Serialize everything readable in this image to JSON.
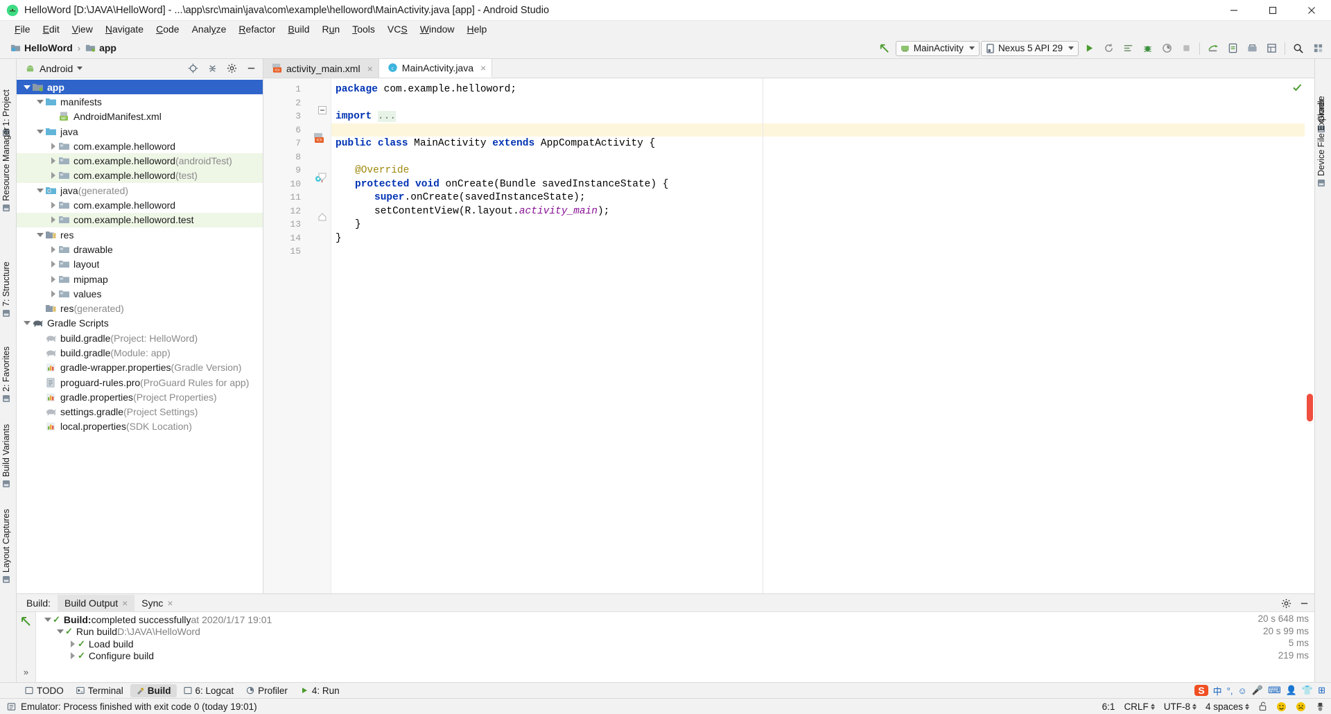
{
  "window": {
    "title": "HelloWord [D:\\JAVA\\HelloWord] - ...\\app\\src\\main\\java\\com\\example\\helloword\\MainActivity.java [app] - Android Studio",
    "icon": "android-studio-logo-icon",
    "controls": {
      "minimize": "minimize-icon",
      "maximize": "maximize-icon",
      "close": "close-icon"
    }
  },
  "menubar": {
    "items": [
      {
        "label": "File",
        "mnemonic": "F"
      },
      {
        "label": "Edit",
        "mnemonic": "E"
      },
      {
        "label": "View",
        "mnemonic": "V"
      },
      {
        "label": "Navigate",
        "mnemonic": "N"
      },
      {
        "label": "Code",
        "mnemonic": "C"
      },
      {
        "label": "Analyze",
        "mnemonic": "y"
      },
      {
        "label": "Refactor",
        "mnemonic": "R"
      },
      {
        "label": "Build",
        "mnemonic": "B"
      },
      {
        "label": "Run",
        "mnemonic": "u"
      },
      {
        "label": "Tools",
        "mnemonic": "T"
      },
      {
        "label": "VCS",
        "mnemonic": "S"
      },
      {
        "label": "Window",
        "mnemonic": "W"
      },
      {
        "label": "Help",
        "mnemonic": "H"
      }
    ]
  },
  "breadcrumb": {
    "items": [
      {
        "label": "HelloWord",
        "icon": "project-folder-icon"
      },
      {
        "label": "app",
        "icon": "module-folder-icon"
      }
    ],
    "separator": "›"
  },
  "toolbar": {
    "back_icon": "back-arrow-icon",
    "run_config": {
      "label": "MainActivity",
      "icon": "android-module-icon"
    },
    "device": {
      "label": "Nexus 5 API 29",
      "icon": "device-icon"
    },
    "buttons": [
      {
        "name": "run-button",
        "icon": "play-icon",
        "color": "#4a9b2f"
      },
      {
        "name": "apply-changes-button",
        "icon": "apply-changes-icon"
      },
      {
        "name": "apply-code-changes-button",
        "icon": "code-changes-icon"
      },
      {
        "name": "debug-button",
        "icon": "bug-icon",
        "color": "#3d9140"
      },
      {
        "name": "profile-button",
        "icon": "profiler-icon"
      },
      {
        "name": "stop-button",
        "icon": "stop-icon"
      },
      {
        "name": "sync-gradle-button",
        "icon": "gradle-sync-icon"
      },
      {
        "name": "avd-manager-button",
        "icon": "avd-manager-icon"
      },
      {
        "name": "sdk-manager-button",
        "icon": "sdk-manager-icon"
      },
      {
        "name": "layout-inspector-button",
        "icon": "layout-inspector-icon"
      },
      {
        "name": "search-everywhere-button",
        "icon": "search-icon"
      },
      {
        "name": "project-structure-button",
        "icon": "project-structure-icon"
      }
    ]
  },
  "left_rail": {
    "items": [
      {
        "label": "1: Project",
        "icon": "project-icon"
      },
      {
        "label": "Resource Manager",
        "icon": "resource-manager-icon"
      },
      {
        "label": "7: Structure",
        "icon": "structure-icon"
      },
      {
        "label": "2: Favorites",
        "icon": "favorites-icon"
      },
      {
        "label": "Build Variants",
        "icon": "build-variants-icon"
      },
      {
        "label": "Layout Captures",
        "icon": "layout-captures-icon"
      }
    ]
  },
  "right_rail": {
    "items": [
      {
        "label": "Gradle",
        "icon": "gradle-icon"
      },
      {
        "label": "Device File Explorer",
        "icon": "device-file-explorer-icon"
      }
    ]
  },
  "project_panel": {
    "view_selector": {
      "label": "Android",
      "icon": "android-head-icon",
      "caret": "chevron-down-icon"
    },
    "header_buttons": [
      {
        "name": "scroll-from-source-button",
        "icon": "target-icon"
      },
      {
        "name": "collapse-all-button",
        "icon": "collapse-all-icon"
      },
      {
        "name": "settings-button",
        "icon": "gear-icon"
      },
      {
        "name": "hide-panel-button",
        "icon": "minimize-panel-icon"
      }
    ],
    "tree": [
      {
        "label": "app",
        "indent": 0,
        "arrow": "down",
        "icon": "module-folder-icon",
        "selected": true,
        "bold": true,
        "sub": ""
      },
      {
        "label": "manifests",
        "indent": 1,
        "arrow": "down",
        "icon": "folder-icon",
        "sub": ""
      },
      {
        "label": "AndroidManifest.xml",
        "indent": 2,
        "arrow": "none",
        "icon": "manifest-file-icon",
        "sub": ""
      },
      {
        "label": "java",
        "indent": 1,
        "arrow": "down",
        "icon": "folder-icon",
        "sub": ""
      },
      {
        "label": "com.example.helloword",
        "indent": 2,
        "arrow": "right",
        "icon": "package-icon",
        "sub": ""
      },
      {
        "label": "com.example.helloword",
        "indent": 2,
        "arrow": "right",
        "icon": "package-icon",
        "sub": " (androidTest)",
        "green": true
      },
      {
        "label": "com.example.helloword",
        "indent": 2,
        "arrow": "right",
        "icon": "package-icon",
        "sub": " (test)",
        "green": true
      },
      {
        "label": "java",
        "indent": 1,
        "arrow": "down",
        "icon": "generated-folder-icon",
        "sub": " (generated)"
      },
      {
        "label": "com.example.helloword",
        "indent": 2,
        "arrow": "right",
        "icon": "package-icon",
        "sub": ""
      },
      {
        "label": "com.example.helloword.test",
        "indent": 2,
        "arrow": "right",
        "icon": "package-icon",
        "sub": "",
        "green": true
      },
      {
        "label": "res",
        "indent": 1,
        "arrow": "down",
        "icon": "res-folder-icon",
        "sub": ""
      },
      {
        "label": "drawable",
        "indent": 2,
        "arrow": "right",
        "icon": "package-icon",
        "sub": ""
      },
      {
        "label": "layout",
        "indent": 2,
        "arrow": "right",
        "icon": "package-icon",
        "sub": ""
      },
      {
        "label": "mipmap",
        "indent": 2,
        "arrow": "right",
        "icon": "package-icon",
        "sub": ""
      },
      {
        "label": "values",
        "indent": 2,
        "arrow": "right",
        "icon": "package-icon",
        "sub": ""
      },
      {
        "label": "res",
        "indent": 1,
        "arrow": "none",
        "icon": "res-folder-icon",
        "sub": " (generated)"
      },
      {
        "label": "Gradle Scripts",
        "indent": 0,
        "arrow": "down",
        "icon": "gradle-elephant-icon",
        "sub": ""
      },
      {
        "label": "build.gradle",
        "indent": 1,
        "arrow": "none",
        "icon": "gradle-file-icon",
        "sub": " (Project: HelloWord)"
      },
      {
        "label": "build.gradle",
        "indent": 1,
        "arrow": "none",
        "icon": "gradle-file-icon",
        "sub": " (Module: app)"
      },
      {
        "label": "gradle-wrapper.properties",
        "indent": 1,
        "arrow": "none",
        "icon": "properties-file-icon",
        "sub": " (Gradle Version)"
      },
      {
        "label": "proguard-rules.pro",
        "indent": 1,
        "arrow": "none",
        "icon": "text-file-icon",
        "sub": " (ProGuard Rules for app)"
      },
      {
        "label": "gradle.properties",
        "indent": 1,
        "arrow": "none",
        "icon": "properties-file-icon",
        "sub": " (Project Properties)"
      },
      {
        "label": "settings.gradle",
        "indent": 1,
        "arrow": "none",
        "icon": "gradle-file-icon",
        "sub": " (Project Settings)"
      },
      {
        "label": "local.properties",
        "indent": 1,
        "arrow": "none",
        "icon": "properties-file-icon",
        "sub": " (SDK Location)"
      }
    ]
  },
  "editor": {
    "tabs": [
      {
        "label": "activity_main.xml",
        "icon": "xml-file-icon",
        "active": false,
        "close": "×"
      },
      {
        "label": "MainActivity.java",
        "icon": "java-class-icon",
        "active": true,
        "close": "×"
      }
    ],
    "line_numbers": [
      "1",
      "2",
      "3",
      "6",
      "7",
      "8",
      "9",
      "10",
      "11",
      "12",
      "13",
      "14",
      "15"
    ],
    "lines": [
      {
        "n": "1",
        "indent": 0,
        "parts": [
          {
            "t": "package ",
            "c": "kw"
          },
          {
            "t": "com.example.helloword;",
            "c": ""
          }
        ]
      },
      {
        "n": "2",
        "indent": 0,
        "parts": []
      },
      {
        "n": "3",
        "indent": 0,
        "parts": [
          {
            "t": "import ",
            "c": "kw"
          },
          {
            "t": "...",
            "c": "dots"
          }
        ]
      },
      {
        "n": "6",
        "indent": 0,
        "parts": [],
        "highlight": true
      },
      {
        "n": "7",
        "indent": 0,
        "parts": [
          {
            "t": "public class ",
            "c": "kw"
          },
          {
            "t": "MainActivity ",
            "c": ""
          },
          {
            "t": "extends ",
            "c": "kw"
          },
          {
            "t": "AppCompatActivity {",
            "c": ""
          }
        ]
      },
      {
        "n": "8",
        "indent": 0,
        "parts": []
      },
      {
        "n": "9",
        "indent": 1,
        "parts": [
          {
            "t": "@Override",
            "c": "anno"
          }
        ]
      },
      {
        "n": "10",
        "indent": 1,
        "parts": [
          {
            "t": "protected void ",
            "c": "kw"
          },
          {
            "t": "onCreate(Bundle savedInstanceState) {",
            "c": ""
          }
        ]
      },
      {
        "n": "11",
        "indent": 2,
        "parts": [
          {
            "t": "super",
            "c": "kw"
          },
          {
            "t": ".onCreate(savedInstanceState);",
            "c": ""
          }
        ]
      },
      {
        "n": "12",
        "indent": 2,
        "parts": [
          {
            "t": "setContentView(R.layout.",
            "c": ""
          },
          {
            "t": "activity_main",
            "c": "fld"
          },
          {
            "t": ");",
            "c": ""
          }
        ]
      },
      {
        "n": "13",
        "indent": 1,
        "parts": [
          {
            "t": "}",
            "c": ""
          }
        ]
      },
      {
        "n": "14",
        "indent": 0,
        "parts": [
          {
            "t": "}",
            "c": ""
          }
        ]
      },
      {
        "n": "15",
        "indent": 0,
        "parts": []
      }
    ],
    "gutter_icons": [
      {
        "line": "7",
        "name": "class-marker-icon"
      },
      {
        "line": "10",
        "name": "override-method-icon"
      }
    ],
    "inspection_status": "ok-check-icon"
  },
  "build_panel": {
    "title": "Build:",
    "tabs": [
      {
        "label": "Build Output",
        "active": true,
        "close": "×"
      },
      {
        "label": "Sync",
        "active": false,
        "close": "×"
      }
    ],
    "header_buttons": [
      {
        "name": "build-settings-button",
        "icon": "gear-icon"
      },
      {
        "name": "hide-build-panel-button",
        "icon": "minimize-panel-icon"
      }
    ],
    "side_buttons": [
      {
        "name": "restart-build-button",
        "icon": "rerun-icon"
      },
      {
        "name": "expand-more-button",
        "icon": "chevrons-right-icon"
      }
    ],
    "rows": [
      {
        "indent": 0,
        "arrow": "down",
        "check": true,
        "bold": "Build:",
        "text": " completed successfully",
        "muted": " at 2020/1/17 19:01",
        "time": "20 s 648 ms"
      },
      {
        "indent": 1,
        "arrow": "down",
        "check": true,
        "bold": "",
        "text": "Run build",
        "muted": " D:\\JAVA\\HelloWord",
        "time": "20 s 99 ms"
      },
      {
        "indent": 2,
        "arrow": "right",
        "check": true,
        "bold": "",
        "text": "Load build",
        "muted": "",
        "time": "5 ms"
      },
      {
        "indent": 2,
        "arrow": "right",
        "check": true,
        "bold": "",
        "text": "Configure build",
        "muted": "",
        "time": "219 ms"
      }
    ]
  },
  "bottom_strip": {
    "items": [
      {
        "label": "TODO",
        "icon": "todo-icon",
        "active": false
      },
      {
        "label": "Terminal",
        "icon": "terminal-icon",
        "active": false
      },
      {
        "label": "Build",
        "icon": "build-hammer-icon",
        "active": true
      },
      {
        "label": "6: Logcat",
        "icon": "logcat-icon",
        "active": false
      },
      {
        "label": "Profiler",
        "icon": "profiler-icon",
        "active": false
      },
      {
        "label": "4: Run",
        "icon": "run-icon",
        "active": false
      }
    ],
    "ime_tray": [
      {
        "name": "sogou-ime-icon",
        "label": "S"
      },
      {
        "name": "chinese-mode-icon",
        "label": "中"
      },
      {
        "name": "punctuation-mode-icon",
        "label": "°,"
      },
      {
        "name": "emoji-icon",
        "label": "☺"
      },
      {
        "name": "voice-input-icon",
        "label": "🎤"
      },
      {
        "name": "soft-keyboard-icon",
        "label": "⌨"
      },
      {
        "name": "user-icon",
        "label": "👤"
      },
      {
        "name": "skin-icon",
        "label": "👕"
      },
      {
        "name": "toolbox-icon",
        "label": "⊞"
      }
    ]
  },
  "statusbar": {
    "message_icon": "event-log-icon",
    "message": "Emulator: Process finished with exit code 0 (today 19:01)",
    "caret_position": "6:1",
    "line_separator": "CRLF",
    "encoding": "UTF-8",
    "indent": "4 spaces",
    "lock_icon": "unlocked-icon",
    "happy_icon": "happy-face-icon",
    "sad_icon": "sad-face-icon",
    "hector_icon": "hector-inspector-icon"
  }
}
